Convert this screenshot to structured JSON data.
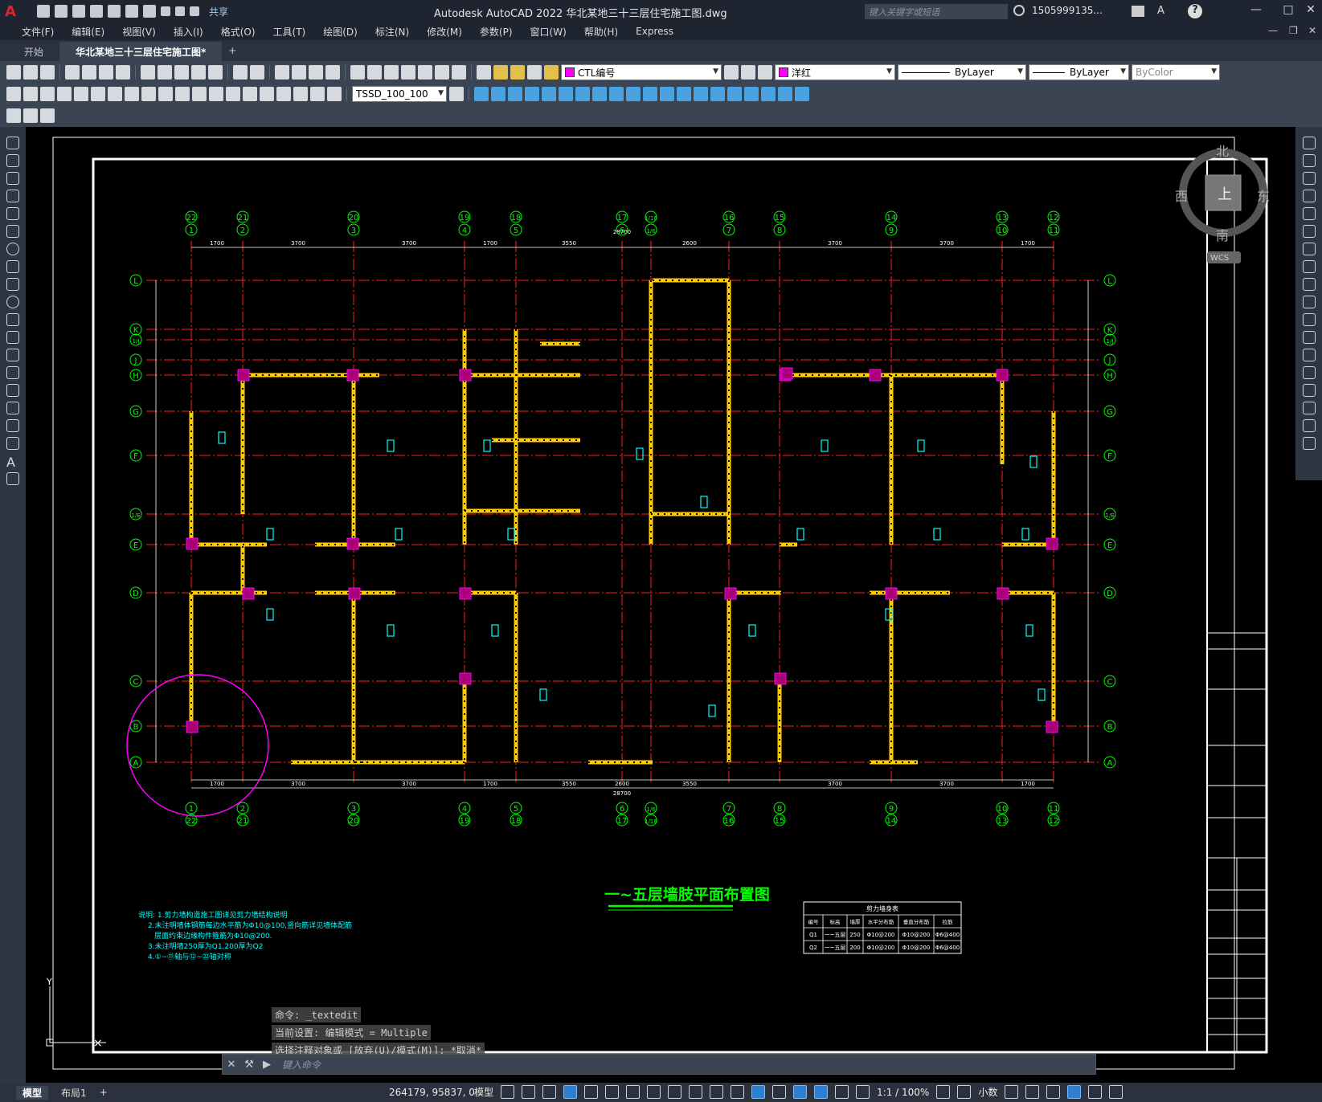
{
  "app": {
    "title": "Autodesk AutoCAD 2022    华北某地三十三层住宅施工图.dwg",
    "share_label": "共享",
    "search_placeholder": "键入关键字或短语",
    "user": "1505999135...",
    "logo": "A"
  },
  "menu": [
    "文件(F)",
    "编辑(E)",
    "视图(V)",
    "插入(I)",
    "格式(O)",
    "工具(T)",
    "绘图(D)",
    "标注(N)",
    "修改(M)",
    "参数(P)",
    "窗口(W)",
    "帮助(H)",
    "Express"
  ],
  "tabs": [
    {
      "label": "开始",
      "active": false
    },
    {
      "label": "华北某地三十三层住宅施工图*",
      "active": true
    }
  ],
  "toolbar": {
    "layer_name": "CTL编号",
    "color_name": "洋红",
    "linetype": "ByLayer",
    "lineweight": "ByLayer",
    "plotstyle": "ByColor",
    "textstyle": "TSSD_100_100"
  },
  "viewcube": {
    "north": "北",
    "south": "南",
    "east": "东",
    "west": "西",
    "top": "上",
    "wcs": "WCS"
  },
  "drawing": {
    "title": "一~五层墙肢平面布置图",
    "axis_top_primary": [
      "1",
      "2",
      "3",
      "4",
      "5",
      "6",
      "1/6",
      "7",
      "8",
      "9",
      "10",
      "11"
    ],
    "axis_top_secondary": [
      "22",
      "21",
      "20",
      "19",
      "18",
      "17",
      "1/16",
      "16",
      "15",
      "14",
      "13",
      "12"
    ],
    "axis_rows": [
      "L",
      "K",
      "1/J",
      "J",
      "H",
      "G",
      "F",
      "1/E",
      "E",
      "D",
      "C",
      "B",
      "A"
    ],
    "top_dims": [
      "1700",
      "3700",
      "3700",
      "1700",
      "3550",
      "2600",
      "3700",
      "3700",
      "1700"
    ],
    "bottom_dims": [
      "1700",
      "3700",
      "3700",
      "1700",
      "3550",
      "2600",
      "3550",
      "3700",
      "3700",
      "1700"
    ],
    "total_width_dim": "28700",
    "notes": [
      "说明: 1.剪力墙构造施工图详见剪力墙结构说明",
      "2.未注明墙体钢筋每边水平筋为Φ10@100,竖向筋详见墙体配筋",
      "层面约束边缘构件箍筋为Φ10@200.",
      "3.未注明墙250厚为Q1,200厚为Q2",
      "4.①~⑪轴与⑫~㉒轴对称"
    ],
    "table": {
      "title": "剪力墙身表",
      "headers": [
        "编号",
        "标高",
        "墙厚",
        "水平分布筋",
        "垂直分布筋",
        "拉筋"
      ],
      "rows": [
        [
          "Q1",
          "一~五层",
          "250",
          "Φ10@200",
          "Φ10@200",
          "Φ6@400"
        ],
        [
          "Q2",
          "一~五层",
          "200",
          "Φ10@200",
          "Φ10@200",
          "Φ6@400"
        ]
      ]
    }
  },
  "command": {
    "history": [
      "命令: _textedit",
      "当前设置: 编辑模式 = Multiple",
      "选择注释对象或 [放弃(U)/模式(M)]: *取消*"
    ],
    "placeholder": "键入命令"
  },
  "status": {
    "tabs": [
      {
        "label": "模型",
        "active": true
      },
      {
        "label": "布局1",
        "active": false
      }
    ],
    "coords": "264179, 95837, 0",
    "model_label": "模型",
    "scale": "1:1 / 100%",
    "units": "小数"
  }
}
